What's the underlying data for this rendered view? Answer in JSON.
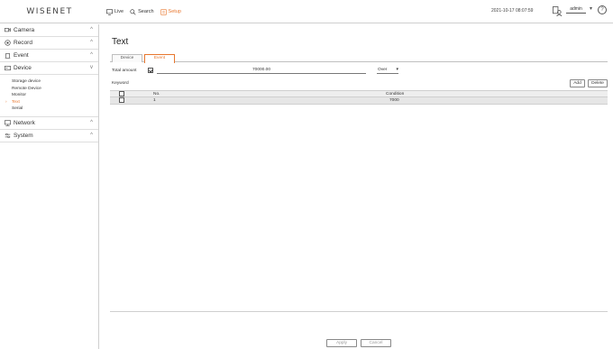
{
  "app": {
    "logo": "WISENET",
    "nav": [
      {
        "label": "Live",
        "icon": "monitor-icon"
      },
      {
        "label": "Search",
        "icon": "search-icon"
      },
      {
        "label": "Setup",
        "icon": "setup-icon"
      }
    ],
    "datetime": "2021-10-17 08:07:59",
    "user": "admin",
    "help": "?"
  },
  "sidebar": {
    "groups": [
      {
        "label": "Camera",
        "icon": "camera-icon",
        "expanded": false
      },
      {
        "label": "Record",
        "icon": "record-icon",
        "expanded": false
      },
      {
        "label": "Event",
        "icon": "event-icon",
        "expanded": false
      },
      {
        "label": "Device",
        "icon": "device-icon",
        "expanded": true,
        "items": [
          "Storage device",
          "Remote Device",
          "Monitor",
          "Text",
          "Serial"
        ],
        "active_item": "Text"
      },
      {
        "label": "Network",
        "icon": "network-icon",
        "expanded": false
      },
      {
        "label": "System",
        "icon": "system-icon",
        "expanded": false
      }
    ]
  },
  "page": {
    "title": "Text",
    "tabs": [
      "Device",
      "Event"
    ],
    "active_tab": "Event",
    "total_amount_label": "Total amount",
    "total_amount_checked": true,
    "total_amount_value": "70000.00",
    "select_value": "Over",
    "keyword_label": "Keyword",
    "add_label": "Add",
    "delete_label": "Delete",
    "table": {
      "headers": {
        "no": "No.",
        "condition": "Condition"
      },
      "rows": [
        {
          "no": "1",
          "condition": "7000"
        }
      ]
    },
    "apply_label": "Apply",
    "cancel_label": "Cancel"
  },
  "colors": {
    "accent": "#e8772e",
    "border": "#cfcfcf",
    "row_bg": "#e6e6e6"
  }
}
